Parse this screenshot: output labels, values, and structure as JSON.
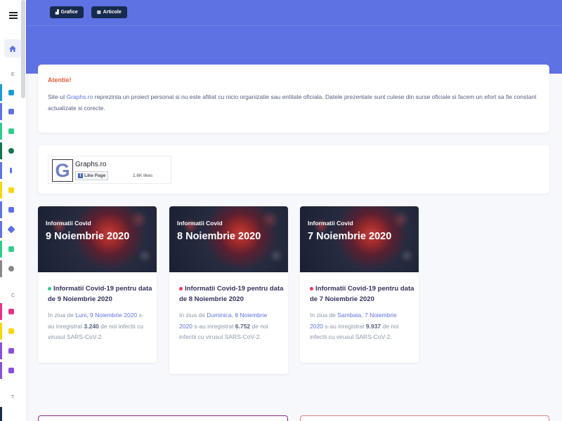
{
  "sidebar": {
    "menu_icon": "hamburger-icon",
    "home_icon": "home-icon",
    "sections": [
      "E",
      "C",
      "T"
    ],
    "items": [
      {
        "icon": "rss-icon",
        "color": "#1a9bd7"
      },
      {
        "icon": "newspaper-icon",
        "color": "#5e72e4"
      },
      {
        "icon": "bar-chart-icon",
        "color": "#2dce89"
      },
      {
        "icon": "virus-icon",
        "color": "#10774c"
      },
      {
        "icon": "info-icon",
        "color": "#5e72e4"
      },
      {
        "icon": "line-chart-icon",
        "color": "#ffd600"
      },
      {
        "icon": "map-icon",
        "color": "#5e72e4"
      },
      {
        "icon": "diamond-icon",
        "color": "#5e72e4"
      },
      {
        "icon": "user-check-icon",
        "color": "#2dce89"
      },
      {
        "icon": "skull-icon",
        "color": "#888888"
      },
      {
        "icon": "monitor-icon",
        "color": "#e6318a"
      },
      {
        "icon": "trend-icon",
        "color": "#ffd600"
      },
      {
        "icon": "calendar-icon",
        "color": "#8a4fd8"
      },
      {
        "icon": "column-chart-icon",
        "color": "#8a4fd8"
      }
    ]
  },
  "header": {
    "btn_grafice": "Grafice",
    "btn_articole": "Articole",
    "grafice_icon": "chart-icon",
    "articole_icon": "keyboard-icon",
    "bg_color": "#5e72e4"
  },
  "alert": {
    "title": "Atentie!",
    "text_pre": "Site-ul ",
    "link": "Graphs.ro",
    "text_post": " reprezinta un proiect personal si nu este afiliat cu nicio organizatie sau entitate oficiala. Datele prezentate sunt culese din surse oficiale si facem un efort sa fie constant actualizate si corecte."
  },
  "facebook": {
    "logo_letter": "G",
    "page_name": "Graphs.ro",
    "like_label": "Like Page",
    "likes": "1.6K likes"
  },
  "news": [
    {
      "img_small": "Informatii Covid",
      "img_big": "9 Noiembrie 2020",
      "dot_color": "#2dce89",
      "title": "Informatii Covid-19 pentru data de 9 Noiembrie 2020",
      "p1": "In ziua de ",
      "day": "Luni, 9 Noiembrie 2020",
      "p2": " s-au inregistrat ",
      "count": "3.240",
      "p3": " de noi infectii cu virusul SARS-CoV-2."
    },
    {
      "img_small": "Informatii Covid",
      "img_big": "8 Noiembrie 2020",
      "dot_color": "#f5365c",
      "title": "Informatii Covid-19 pentru data de 8 Noiembrie 2020",
      "p1": "In ziua de ",
      "day": "Duminica, 8 Noiembrie 2020",
      "p2": " s-au inregistrat ",
      "count": "6.752",
      "p3": " de noi infectii cu virusul SARS-CoV-2."
    },
    {
      "img_small": "Informatii Covid",
      "img_big": "7 Noiembrie 2020",
      "dot_color": "#f5365c",
      "title": "Informatii Covid-19 pentru data de 7 Noiembrie 2020",
      "p1": "In ziua de ",
      "day": "Sambata, 7 Noiembrie 2020",
      "p2": " s-au inregistrat ",
      "count": "9.937",
      "p3": " de noi infectii cu virusul SARS-CoV-2."
    }
  ]
}
